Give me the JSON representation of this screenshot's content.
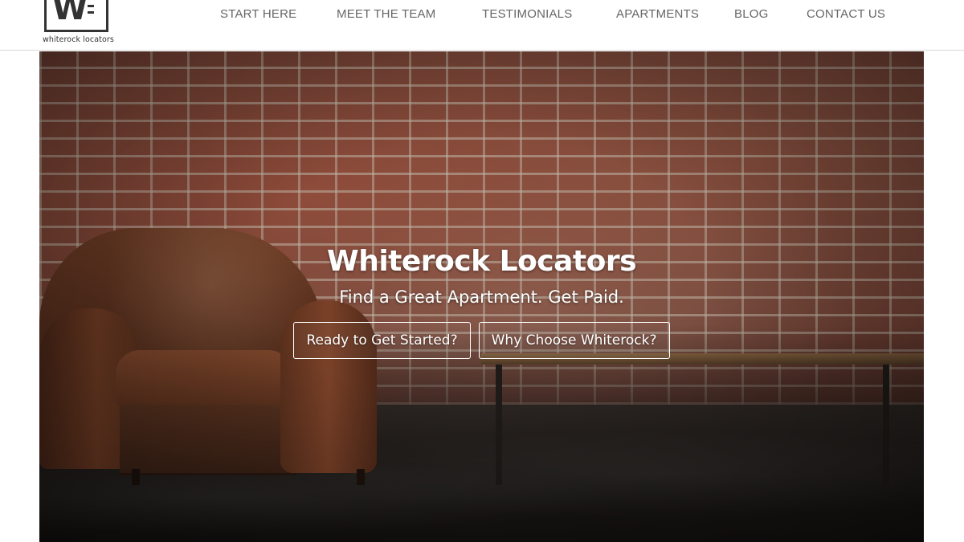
{
  "brand": {
    "logo_letter": "W",
    "name_lower": "whiterock locators"
  },
  "nav": {
    "items": [
      {
        "label": "START HERE"
      },
      {
        "label": "MEET THE TEAM"
      },
      {
        "label": "TESTIMONIALS"
      },
      {
        "label": "APARTMENTS"
      },
      {
        "label": "BLOG"
      },
      {
        "label": "CONTACT US"
      }
    ]
  },
  "hero": {
    "title": "Whiterock Locators",
    "subtitle": "Find a Great Apartment. Get Paid.",
    "primary_button": "Ready to Get Started?",
    "secondary_button": "Why Choose Whiterock?"
  },
  "colors": {
    "nav_text": "#666666",
    "hero_text": "#ffffff",
    "header_border": "#d9d9d9",
    "logo": "#333333"
  }
}
